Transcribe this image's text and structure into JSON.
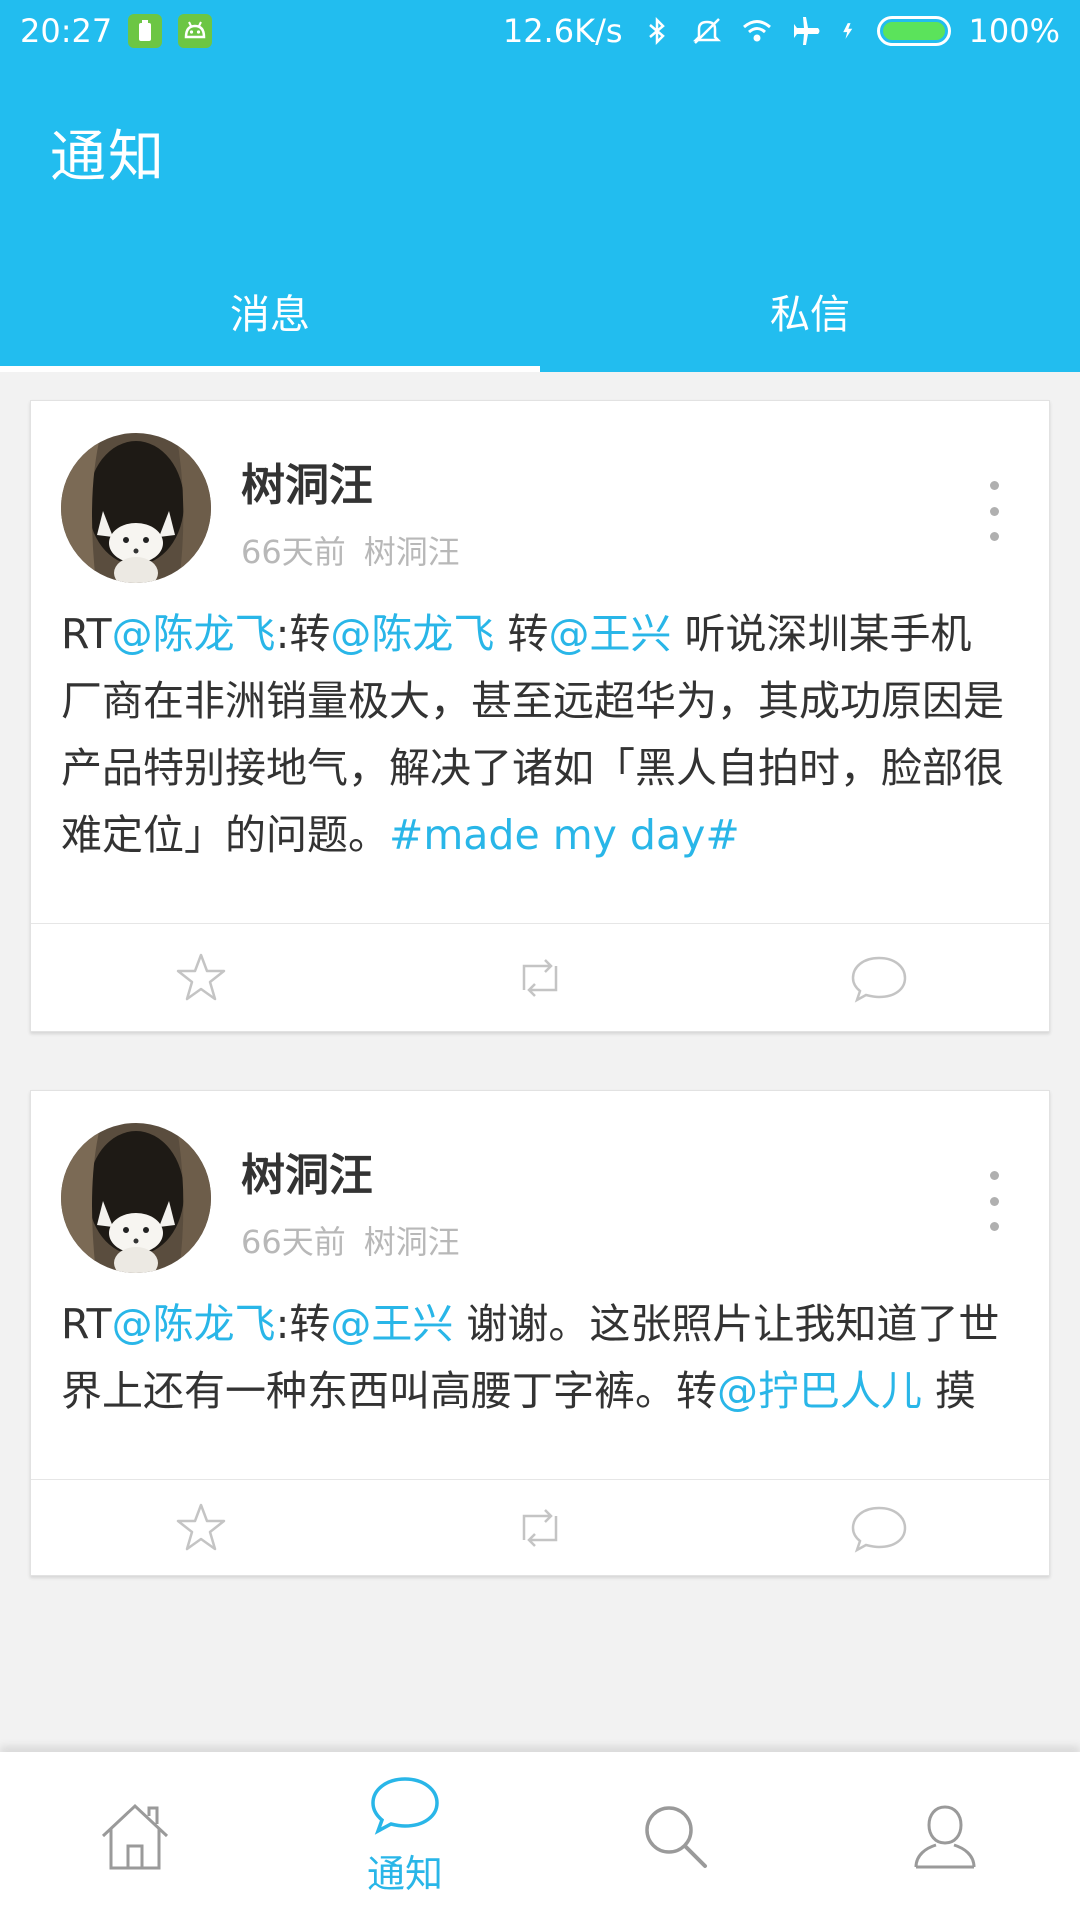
{
  "status_bar": {
    "time": "20:27",
    "network_speed": "12.6K/s",
    "battery_percent": "100%",
    "battery_level": 1.0
  },
  "header": {
    "title": "通知",
    "tabs": [
      {
        "label": "消息",
        "active": true
      },
      {
        "label": "私信",
        "active": false
      }
    ]
  },
  "colors": {
    "primary": "#22bdef",
    "link": "#29b6e8",
    "text": "#333333",
    "meta": "#b8b8b8"
  },
  "posts": [
    {
      "author": "树洞汪",
      "time_ago": "66天前",
      "source": "树洞汪",
      "text_segments": [
        {
          "text": "RT",
          "type": "plain"
        },
        {
          "text": "@陈龙飞",
          "type": "mention"
        },
        {
          "text": ":转",
          "type": "plain"
        },
        {
          "text": "@陈龙飞",
          "type": "mention"
        },
        {
          "text": " 转",
          "type": "plain"
        },
        {
          "text": "@王兴",
          "type": "mention"
        },
        {
          "text": " 听说深圳某手机厂商在非洲销量极大，甚至远超华为，其成功原因是产品特别接地气，解决了诸如「黑人自拍时，脸部很难定位」的问题。",
          "type": "plain"
        },
        {
          "text": "#made my day#",
          "type": "hashtag"
        }
      ],
      "actions": [
        "star-icon",
        "repost-icon",
        "comment-icon"
      ]
    },
    {
      "author": "树洞汪",
      "time_ago": "66天前",
      "source": "树洞汪",
      "text_segments": [
        {
          "text": "RT",
          "type": "plain"
        },
        {
          "text": "@陈龙飞",
          "type": "mention"
        },
        {
          "text": ":转",
          "type": "plain"
        },
        {
          "text": "@王兴",
          "type": "mention"
        },
        {
          "text": " 谢谢。这张照片让我知道了世界上还有一种东西叫高腰丁字裤。转",
          "type": "plain"
        },
        {
          "text": "@拧巴人儿",
          "type": "mention"
        },
        {
          "text": " 摸",
          "type": "plain"
        }
      ],
      "actions": [
        "star-icon",
        "repost-icon",
        "comment-icon"
      ]
    }
  ],
  "bottom_nav": {
    "items": [
      {
        "icon": "home-icon",
        "label": "",
        "active": false
      },
      {
        "icon": "notification-icon",
        "label": "通知",
        "active": true
      },
      {
        "icon": "search-icon",
        "label": "",
        "active": false
      },
      {
        "icon": "profile-icon",
        "label": "",
        "active": false
      }
    ]
  }
}
